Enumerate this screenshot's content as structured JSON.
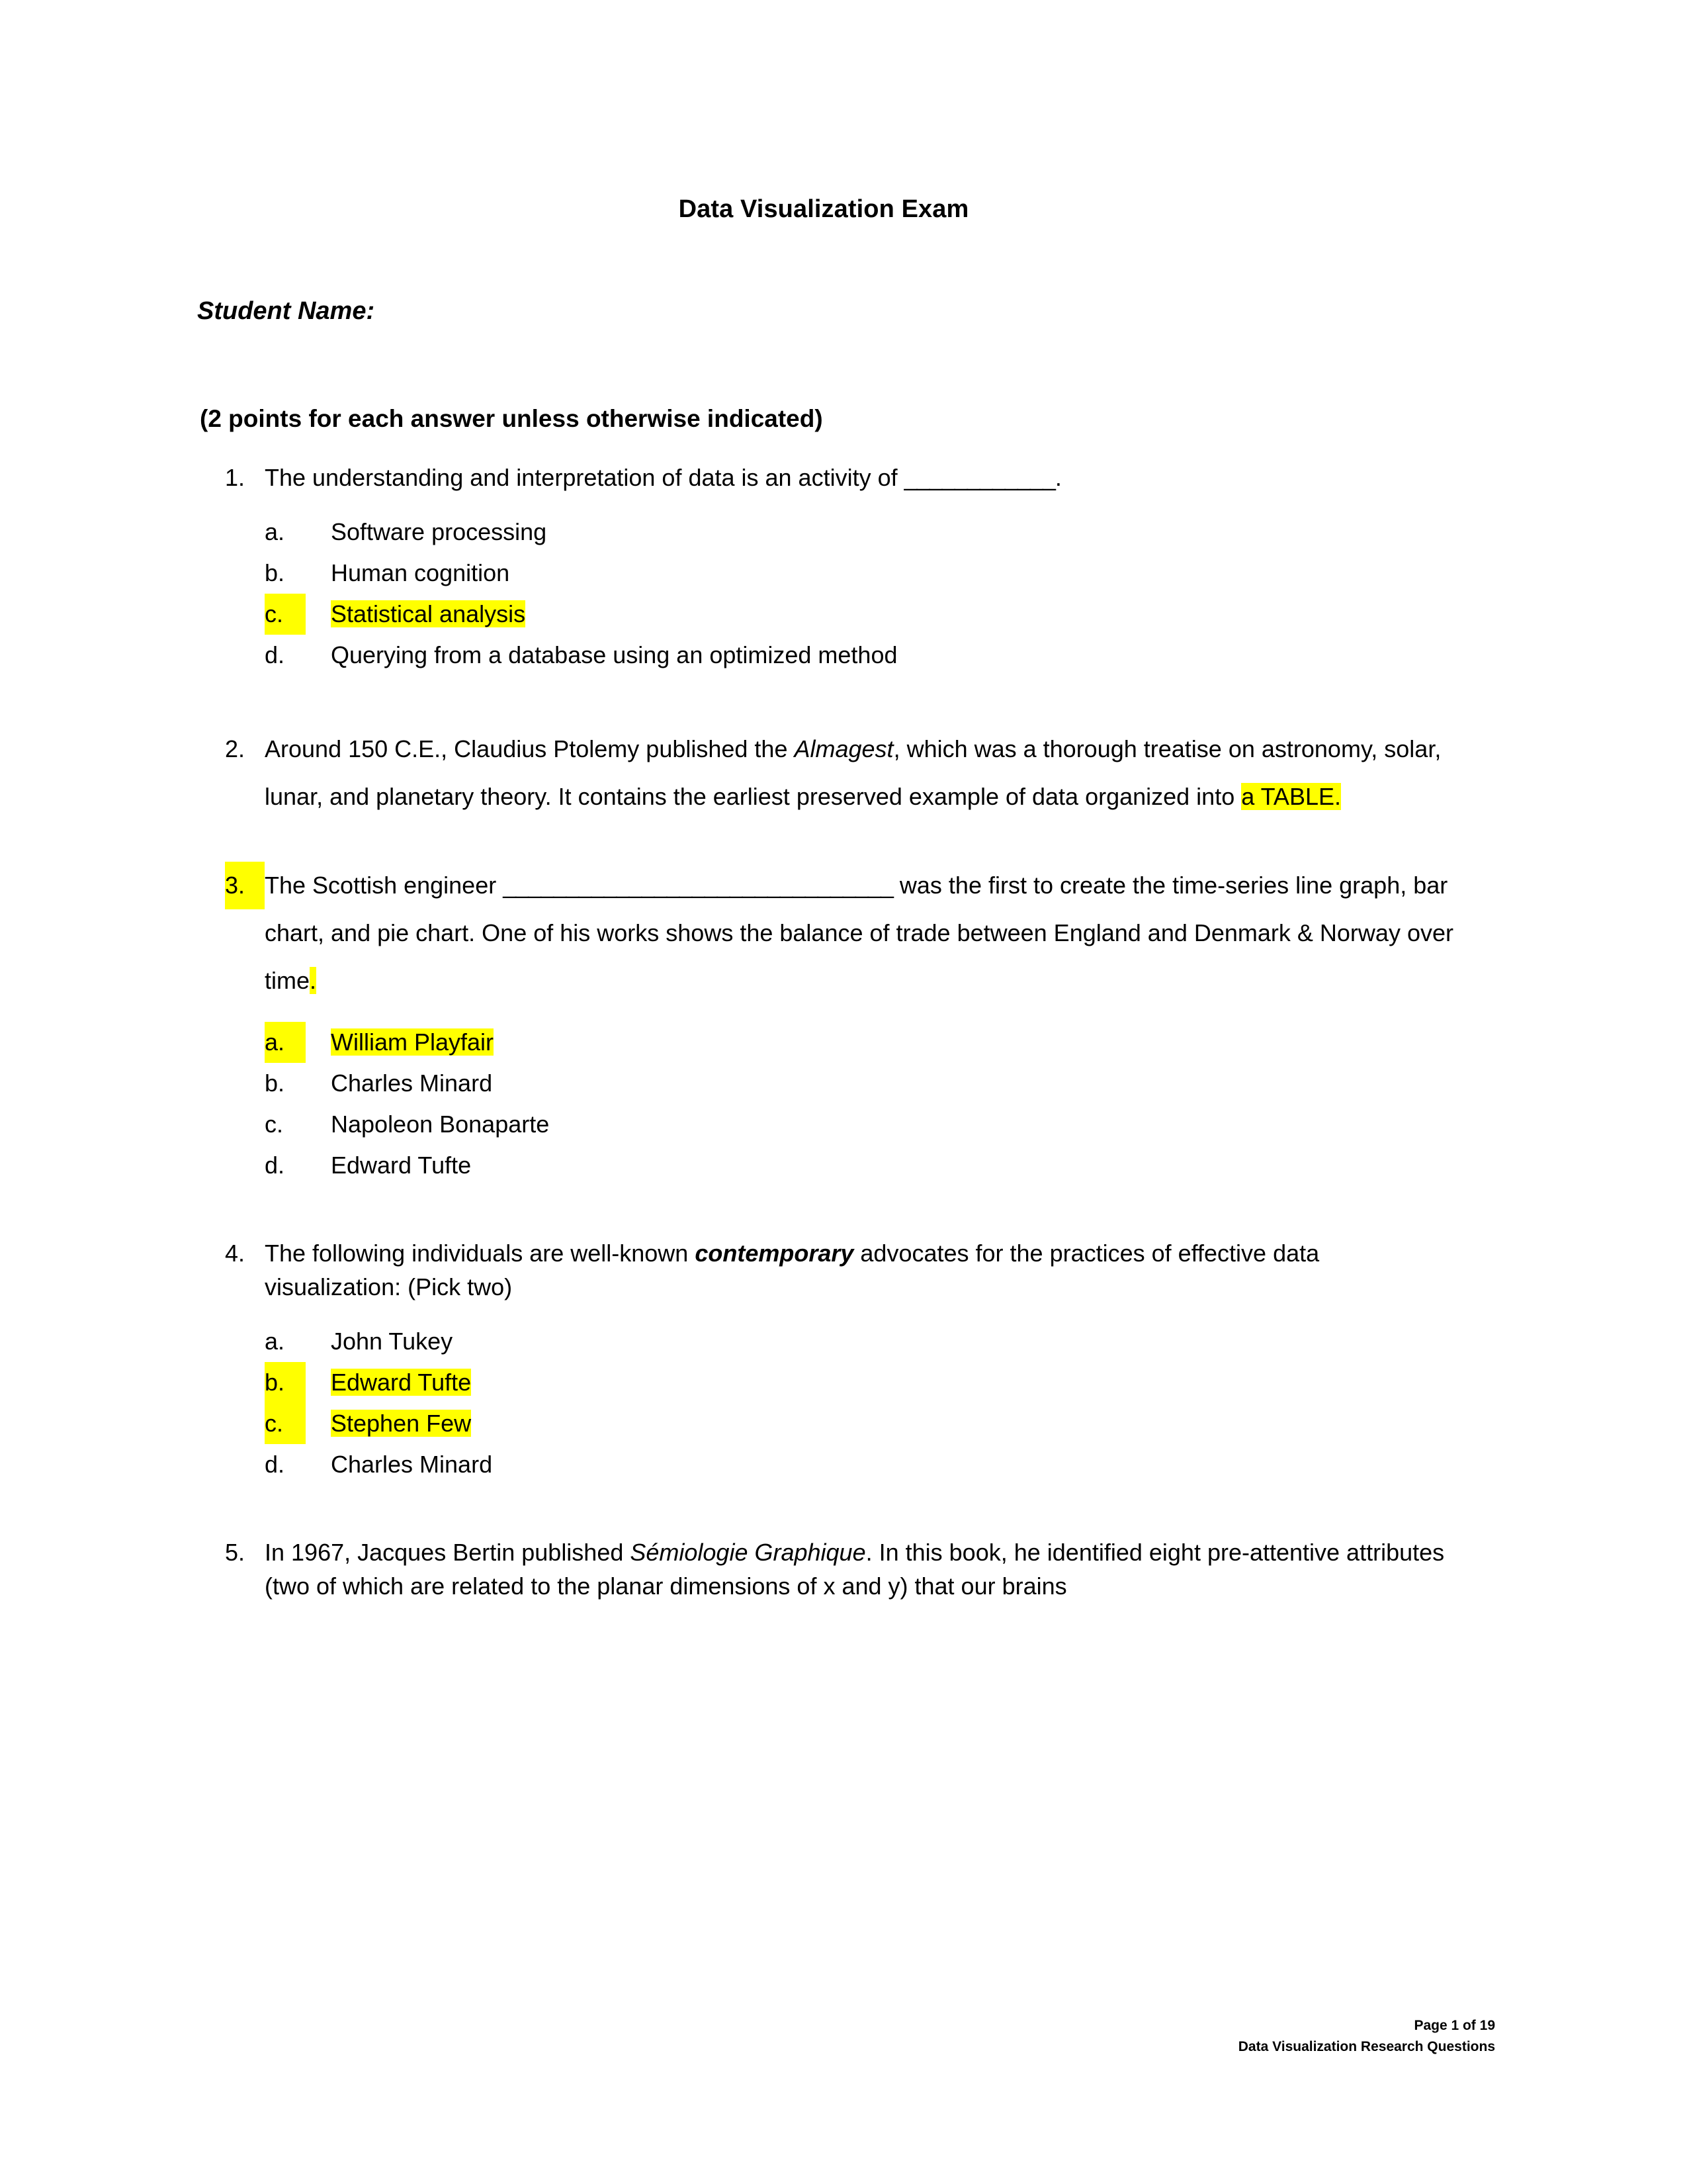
{
  "document": {
    "title": "Data Visualization Exam",
    "student_name_label": "Student Name:",
    "points_note": "(2 points for each answer unless otherwise indicated)"
  },
  "questions": [
    {
      "number": "1.",
      "number_highlighted": false,
      "text_before": "The understanding and interpretation of data is an activity of ",
      "blank": "____________",
      "text_after": ".",
      "choices": [
        {
          "marker": "a.",
          "text": "Software processing",
          "highlighted": false
        },
        {
          "marker": "b.",
          "text": "Human cognition",
          "highlighted": false
        },
        {
          "marker": "c.",
          "text": "Statistical analysis",
          "highlighted": true
        },
        {
          "marker": "d.",
          "text": "Querying from a database using an optimized method",
          "highlighted": false
        }
      ]
    },
    {
      "number": "2.",
      "number_highlighted": false,
      "seg1": "Around 150 C.E., Claudius Ptolemy published the ",
      "italic": "Almagest",
      "seg2": ", which was a thorough treatise on astronomy, solar, lunar, and planetary theory.  It contains the earliest preserved example of data organized into ",
      "highlight_tail": "a TABLE.",
      "choices": []
    },
    {
      "number": "3.",
      "number_highlighted": true,
      "seg1": "The Scottish engineer ",
      "blank": "_______________________________",
      "seg2": " was the first to create the time-series line graph, bar chart, and pie chart.  One of his works shows the balance of trade between England and Denmark & Norway over time",
      "highlight_tail": ".",
      "choices": [
        {
          "marker": "a.",
          "text": "William Playfair",
          "highlighted": true
        },
        {
          "marker": "b.",
          "text": "Charles Minard",
          "highlighted": false
        },
        {
          "marker": "c.",
          "text": "Napoleon Bonaparte",
          "highlighted": false
        },
        {
          "marker": "d.",
          "text": "Edward Tufte",
          "highlighted": false
        }
      ]
    },
    {
      "number": "4.",
      "number_highlighted": false,
      "seg1": "The following individuals are well-known ",
      "bold_italic": "contemporary",
      "seg2": " advocates for the practices of effective data visualization: (Pick two)",
      "choices": [
        {
          "marker": "a.",
          "text": "John Tukey",
          "highlighted": false
        },
        {
          "marker": "b.",
          "text": "Edward Tufte",
          "highlighted": true
        },
        {
          "marker": "c.",
          "text": "Stephen Few",
          "highlighted": true
        },
        {
          "marker": "d.",
          "text": "Charles Minard",
          "highlighted": false
        }
      ]
    },
    {
      "number": "5.",
      "number_highlighted": false,
      "seg1": "In 1967, Jacques Bertin published ",
      "italic": "Sémiologie Graphique",
      "seg2": ".  In this book, he identified eight pre-attentive attributes (two of which are related to the planar dimensions of x and y) that our brains",
      "choices": []
    }
  ],
  "footer": {
    "page_number": "Page 1 of 19",
    "doc_name": "Data Visualization Research Questions"
  },
  "colors": {
    "highlight": "#FFFF00",
    "text": "#000000",
    "page_background": "#FFFFFF"
  }
}
